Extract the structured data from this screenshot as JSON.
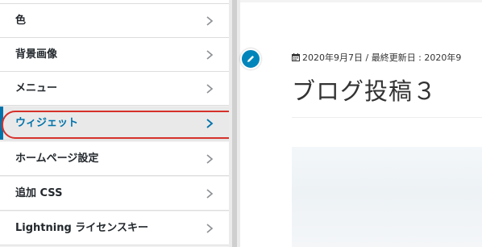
{
  "customizer": {
    "items": [
      {
        "label": "色"
      },
      {
        "label": "背景画像"
      },
      {
        "label": "メニュー"
      },
      {
        "label": "ウィジェット",
        "active": true
      },
      {
        "label": "ホームページ設定"
      },
      {
        "label": "追加 CSS"
      },
      {
        "label": "Lightning ライセンスキー"
      }
    ],
    "accent_color": "#0073aa",
    "highlight_color": "#d6312a"
  },
  "preview": {
    "edit_icon": "pencil-icon",
    "meta_icon": "calendar-icon",
    "meta_text": "2020年9月7日 / 最終更新日 : 2020年9",
    "post_title": "ブログ投稿３"
  }
}
